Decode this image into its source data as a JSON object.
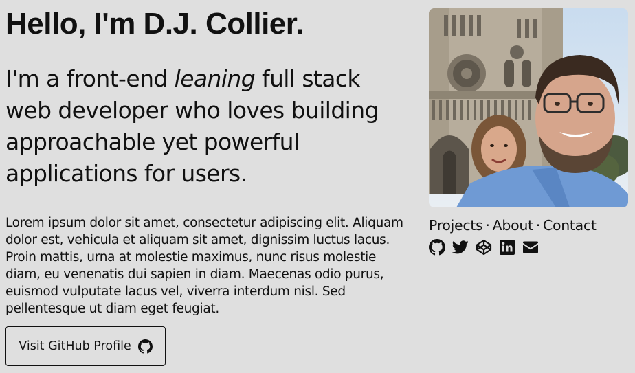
{
  "hero": {
    "heading": "Hello, I'm D.J. Collier.",
    "lead_before": "I'm a front-end ",
    "lead_emphasis": "leaning",
    "lead_after": " full stack web developer who loves building approachable yet powerful applications for users.",
    "body": "Lorem ipsum dolor sit amet, consectetur adipiscing elit. Aliquam dolor est, vehicula et aliquam sit amet, dignissim luctus lacus. Proin mattis, urna at molestie maximus, nunc risus molestie diam, eu venenatis dui sapien in diam. Maecenas odio purus, euismod vulputate lacus vel, viverra interdum nisl. Sed pellentesque ut diam eget feugiat.",
    "button_label": "Visit GitHub Profile",
    "button_icon": "github-icon"
  },
  "nav": {
    "links": [
      "Projects",
      "About",
      "Contact"
    ],
    "separator": "·"
  },
  "socials": {
    "icons": [
      "github-icon",
      "twitter-icon",
      "codepen-icon",
      "linkedin-icon",
      "envelope-icon"
    ]
  },
  "colors": {
    "background": "#dfdfdf",
    "text": "#111111"
  }
}
